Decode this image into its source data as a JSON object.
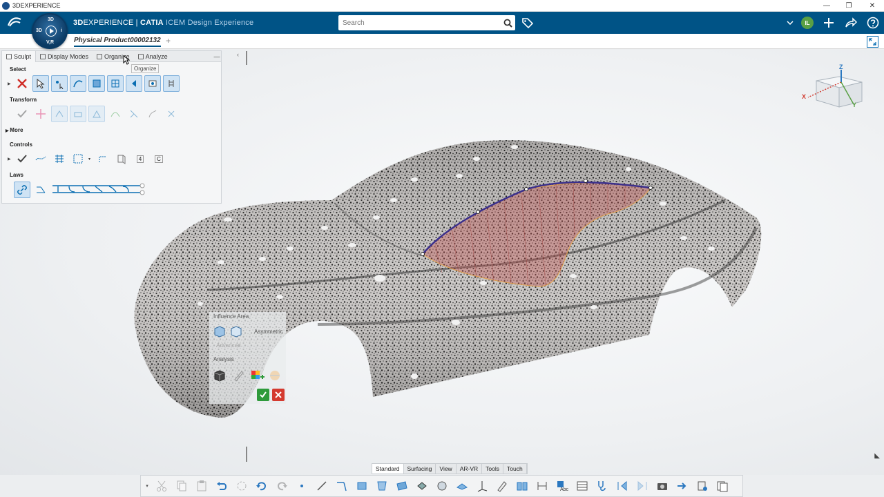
{
  "window": {
    "title": "3DEXPERIENCE",
    "minimize": "—",
    "maximize": "❐",
    "close": "✕"
  },
  "topbar": {
    "logo": "3DS",
    "compass": {
      "top": "3D",
      "left": "3D",
      "bottom": "V,R",
      "right": "i"
    },
    "brand": {
      "part1": "3D",
      "part2": "EXPERIENCE",
      "sep": " | ",
      "part3": "CATIA",
      "part4": " ICEM Design Experience"
    },
    "search_placeholder": "Search",
    "avatar": "IL",
    "icons": [
      "search-icon",
      "tag-icon",
      "chevron-down-icon",
      "plus-icon",
      "share-icon",
      "help-icon"
    ]
  },
  "tabs": {
    "document": "Physical Product00002132",
    "add": "+"
  },
  "panel": {
    "tabs": [
      {
        "label": "Sculpt"
      },
      {
        "label": "Display Modes"
      },
      {
        "label": "Organize"
      },
      {
        "label": "Analyze"
      }
    ],
    "minimize": "—",
    "sections": {
      "select": "Select",
      "transform": "Transform",
      "more": "More",
      "controls": "Controls",
      "laws": "Laws"
    },
    "controls_num": "4",
    "controls_letter": "C"
  },
  "tooltip": "Organize",
  "influence": {
    "title": "Influence Area",
    "asymmetric": "Asymmetric",
    "advanced": "Advanced",
    "analysis": "Analysis"
  },
  "navcube": {
    "z": "Z",
    "x": "X",
    "y": "Y"
  },
  "actionbar": {
    "tabs": [
      {
        "label": "Standard",
        "active": true
      },
      {
        "label": "Surfacing",
        "active": false
      },
      {
        "label": "View",
        "active": false
      },
      {
        "label": "AR-VR",
        "active": false
      },
      {
        "label": "Tools",
        "active": false
      },
      {
        "label": "Touch",
        "active": false
      }
    ]
  },
  "colors": {
    "brand_blue": "#005386",
    "accent": "#0b6fb3",
    "ok": "#2e9a3b",
    "cancel": "#d43a2f",
    "curve": "#3b2f8c",
    "patch": "#c0504d"
  }
}
